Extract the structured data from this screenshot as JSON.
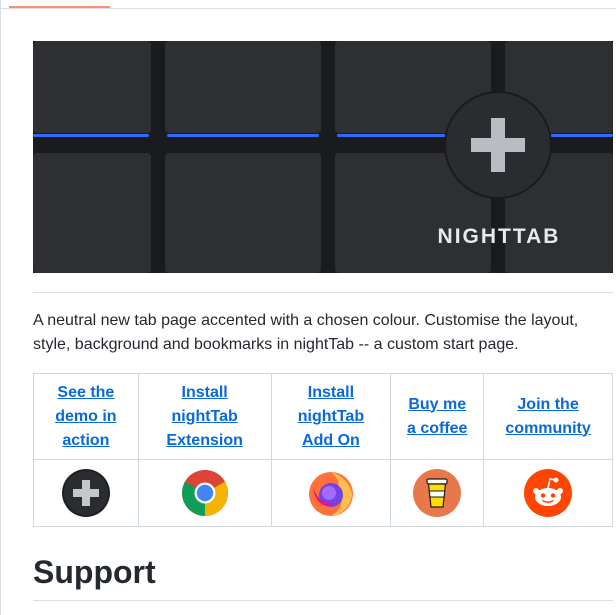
{
  "banner": {
    "logo_text": "NIGHTTAB",
    "accent_color": "#2f6bff",
    "tile_color": "#2d2f33",
    "background_color": "#1a1b1e"
  },
  "description": "A neutral new tab page accented with a chosen colour. Customise the layout, style, background and bookmarks in nightTab -- a custom start page.",
  "links": [
    {
      "label_lines": [
        "See the",
        "demo in",
        "action"
      ],
      "icon": "nighttab-plus-icon"
    },
    {
      "label_lines": [
        "Install",
        "nightTab",
        "Extension"
      ],
      "icon": "chrome-icon"
    },
    {
      "label_lines": [
        "Install",
        "nightTab",
        "Add On"
      ],
      "icon": "firefox-icon"
    },
    {
      "label_lines": [
        "Buy me",
        "a coffee"
      ],
      "icon": "coffee-cup-icon"
    },
    {
      "label_lines": [
        "Join the",
        "community"
      ],
      "icon": "reddit-icon"
    }
  ],
  "support_heading": "Support",
  "colors": {
    "link": "#0969da",
    "tab_active": "#fd8c73",
    "coffee_bg": "#e8784c",
    "reddit_bg": "#ff4500"
  }
}
